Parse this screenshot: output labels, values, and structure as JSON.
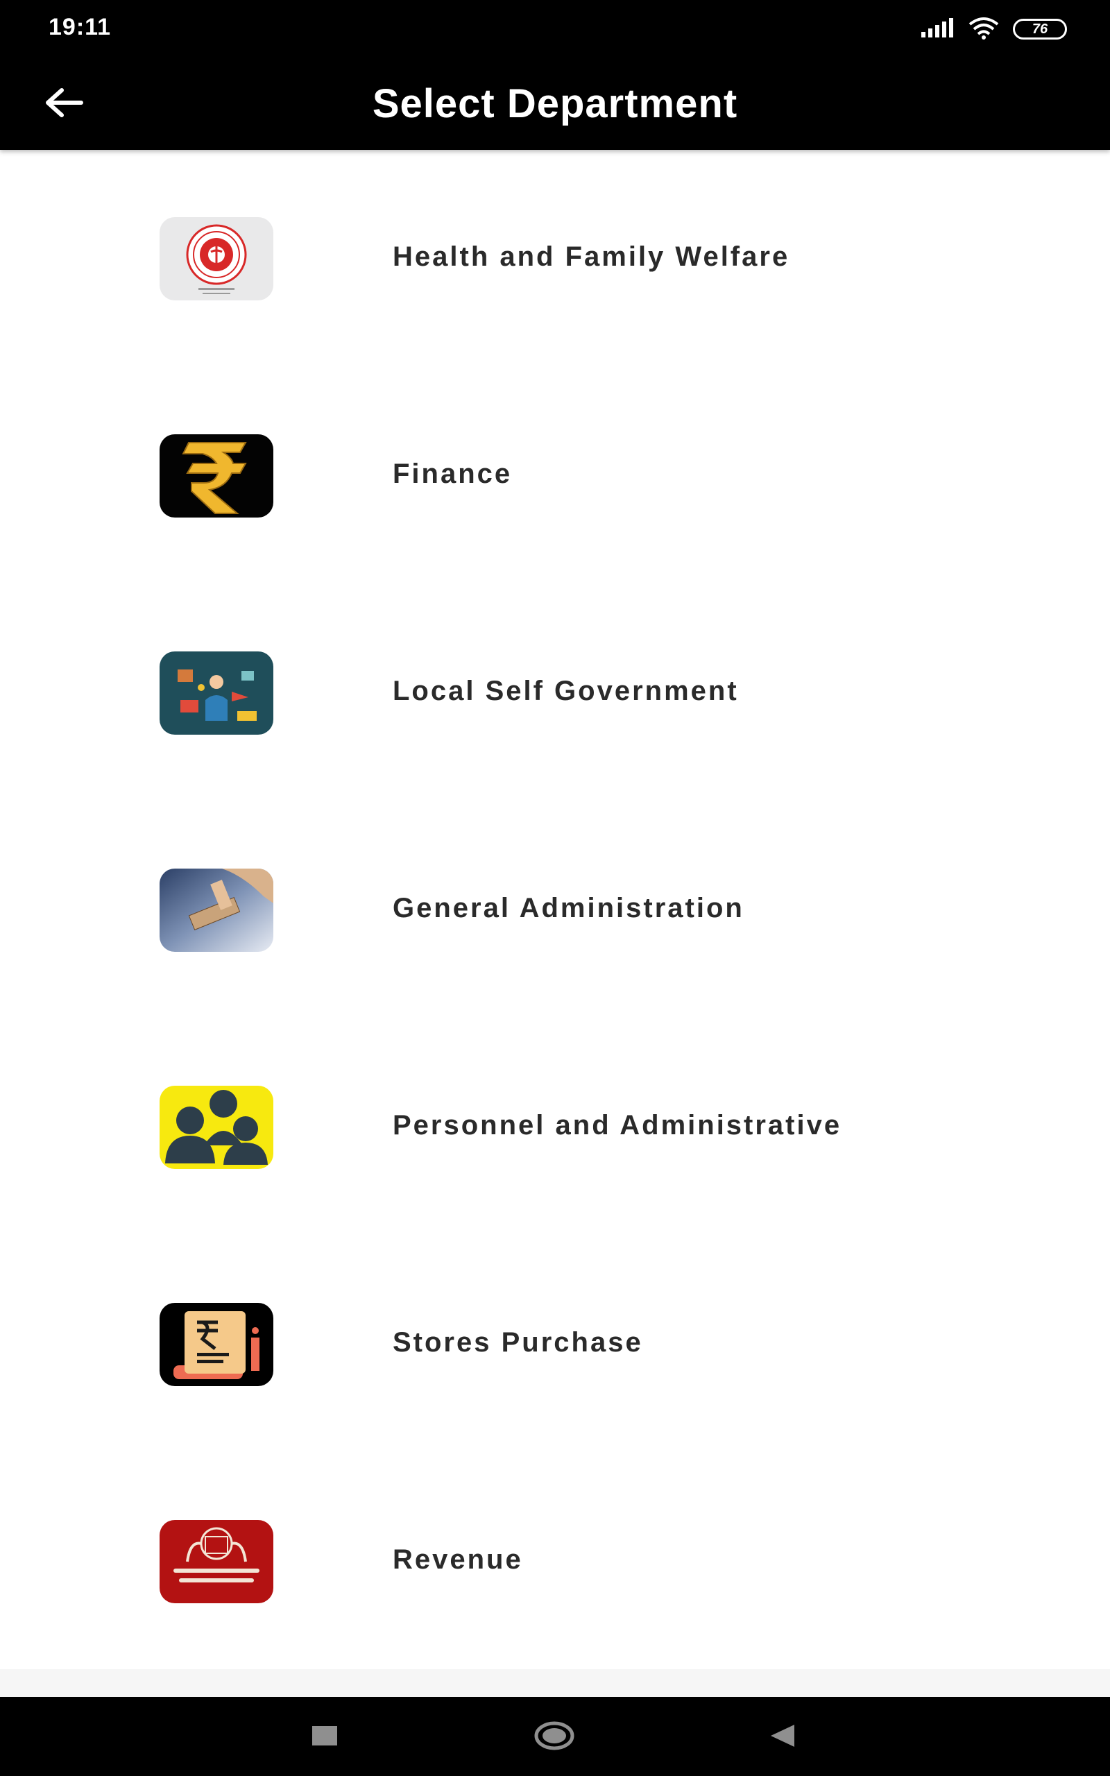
{
  "status_bar": {
    "time": "19:11",
    "battery": "76",
    "icons": [
      "signal-icon",
      "wifi-icon",
      "battery-icon"
    ]
  },
  "app_bar": {
    "title": "Select Department",
    "back_icon": "arrow-left-icon"
  },
  "departments": [
    {
      "label": "Health and Family Welfare",
      "icon": "health-department-emblem-icon"
    },
    {
      "label": "Finance",
      "icon": "rupee-icon"
    },
    {
      "label": "Local Self Government",
      "icon": "local-government-icon"
    },
    {
      "label": "General Administration",
      "icon": "stamp-icon"
    },
    {
      "label": "Personnel and Administrative",
      "icon": "people-icon"
    },
    {
      "label": "Stores Purchase",
      "icon": "receipt-icon"
    },
    {
      "label": "Revenue",
      "icon": "revenue-emblem-icon"
    }
  ],
  "nav_bar": {
    "icons": [
      "recents-square-icon",
      "home-circle-icon",
      "back-triangle-icon"
    ]
  },
  "colors": {
    "bar_background": "#000000",
    "bar_text": "#ffffff",
    "list_background": "#ffffff",
    "label_text": "#2a2a2a"
  }
}
